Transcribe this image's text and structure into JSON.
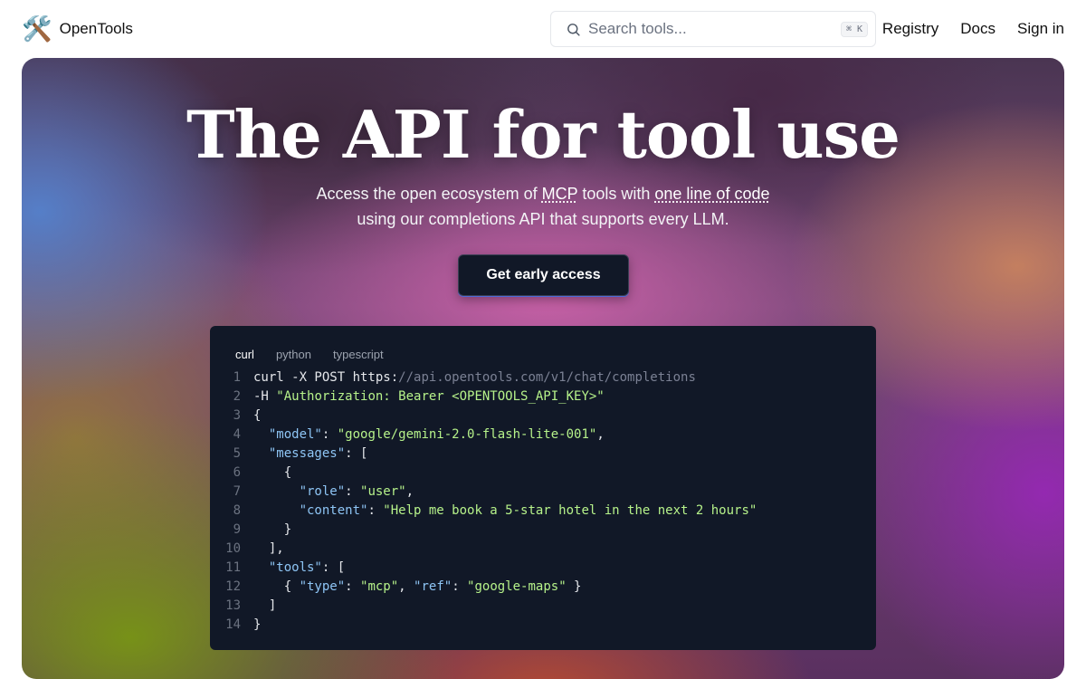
{
  "header": {
    "brand_icon": "🛠️",
    "brand_name": "OpenTools",
    "search_placeholder": "Search tools...",
    "search_shortcut": "⌘ K",
    "nav": [
      "Registry",
      "Docs",
      "Sign in"
    ]
  },
  "hero": {
    "title": "The API for tool use",
    "subtitle_part1": "Access the open ecosystem of ",
    "subtitle_mcp": "MCP",
    "subtitle_part2": " tools with ",
    "subtitle_link": "one line of code",
    "subtitle_line2": "using our completions API that supports every LLM.",
    "cta_label": "Get early access"
  },
  "code": {
    "tabs": [
      "curl",
      "python",
      "typescript"
    ],
    "active_tab": "curl",
    "line_numbers": [
      "1",
      "2",
      "3",
      "4",
      "5",
      "6",
      "7",
      "8",
      "9",
      "10",
      "11",
      "12",
      "13",
      "14"
    ],
    "url_scheme": "curl -X POST https:",
    "url_rest": "//api.opentools.com/v1/chat/completions",
    "auth_flag": "-H ",
    "auth_value": "\"Authorization: Bearer <OPENTOOLS_API_KEY>\"",
    "model_key": "\"model\"",
    "model_value": "\"google/gemini-2.0-flash-lite-001\"",
    "messages_key": "\"messages\"",
    "role_key": "\"role\"",
    "role_value": "\"user\"",
    "content_key": "\"content\"",
    "content_value": "\"Help me book a 5-star hotel in the next 2 hours\"",
    "tools_key": "\"tools\"",
    "type_key": "\"type\"",
    "type_value": "\"mcp\"",
    "ref_key": "\"ref\"",
    "ref_value": "\"google-maps\""
  },
  "colors": {
    "code_bg": "#111827",
    "code_key": "#8ec5f5",
    "code_string": "#b6f28a",
    "cta_bg": "#111827"
  }
}
